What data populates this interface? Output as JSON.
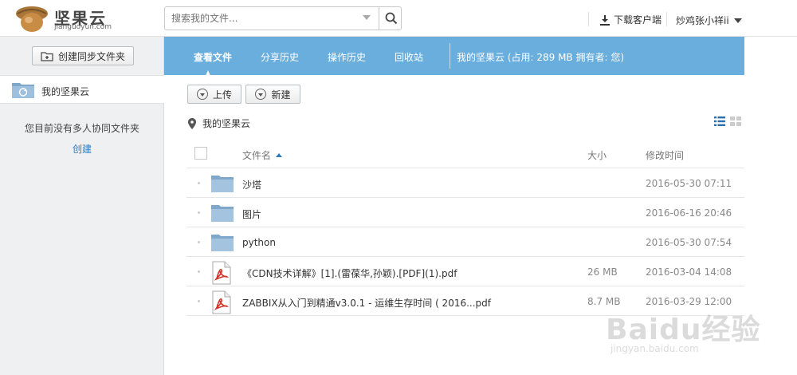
{
  "header": {
    "logo_title": "坚果云",
    "logo_subtitle": "jianguoyun.com",
    "search_placeholder": "搜索我的文件...",
    "download_label": "下载客户端",
    "user_name": "炒鸡张小祥ii"
  },
  "sidebar": {
    "create_sync_label": "创建同步文件夹",
    "folder_label": "我的坚果云",
    "empty_message": "您目前没有多人协同文件夹",
    "create_link": "创建"
  },
  "tabs": {
    "items": [
      "查看文件",
      "分享历史",
      "操作历史",
      "回收站"
    ],
    "info": "我的坚果云 (占用:  289 MB   拥有者:  您)"
  },
  "toolbar": {
    "upload_label": "上传",
    "new_label": "新建"
  },
  "breadcrumb": "我的坚果云",
  "table": {
    "headers": {
      "name": "文件名",
      "size": "大小",
      "modified": "修改时间"
    },
    "rows": [
      {
        "type": "folder",
        "name": "沙塔",
        "size": "",
        "modified": "2016-05-30 07:11"
      },
      {
        "type": "folder",
        "name": "图片",
        "size": "",
        "modified": "2016-06-16 20:46"
      },
      {
        "type": "folder",
        "name": "python",
        "size": "",
        "modified": "2016-05-30 07:54"
      },
      {
        "type": "pdf",
        "name": "《CDN技术详解》[1].(雷葆华,孙颖).[PDF](1).pdf",
        "size": "26 MB",
        "modified": "2016-03-04 14:08"
      },
      {
        "type": "pdf",
        "name": "ZABBIX从入门到精通v3.0.1 - 运维生存时间 ( 2016...pdf",
        "size": "8.7 MB",
        "modified": "2016-03-29 12:00"
      }
    ]
  },
  "watermark": {
    "main": "Baidu经验",
    "sub": "jingyan.baidu.com"
  },
  "colors": {
    "tabbar": "#6aaede",
    "link": "#2b7bc0",
    "sidebar": "#eef0f2"
  }
}
